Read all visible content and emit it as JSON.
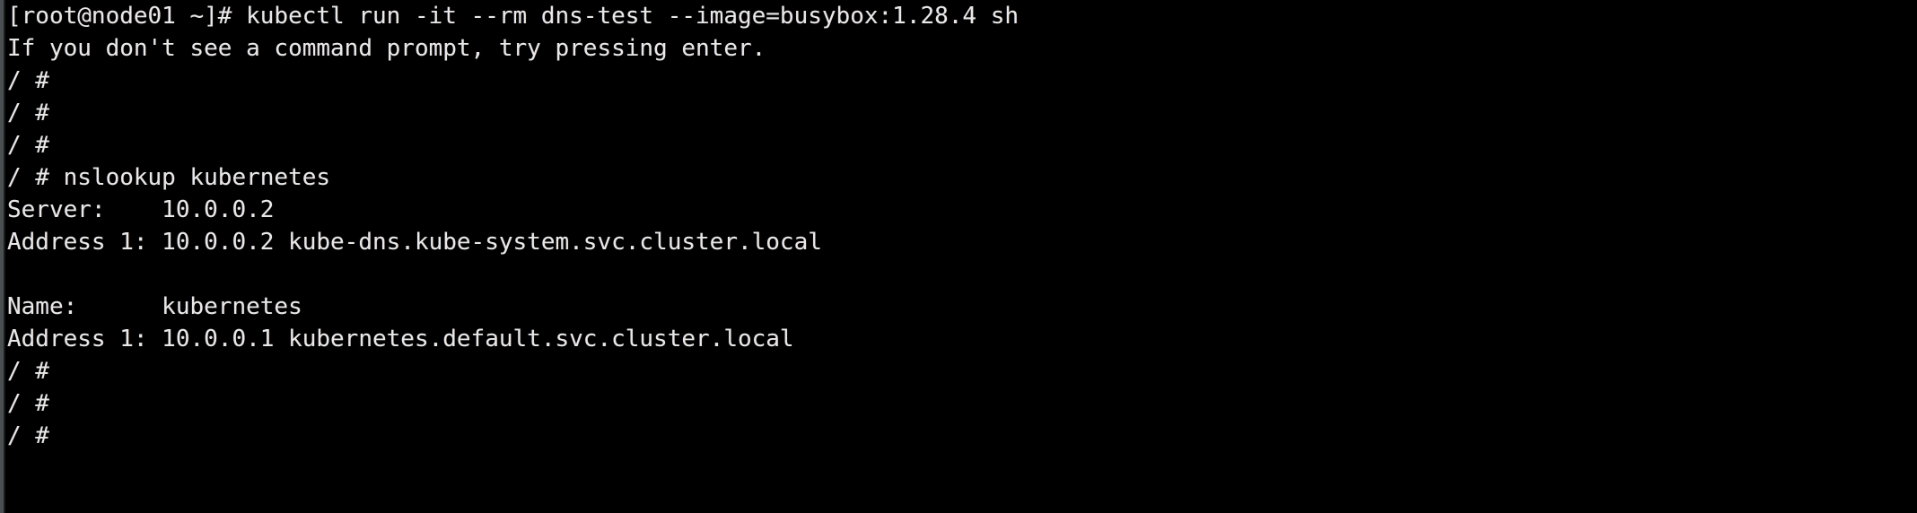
{
  "terminal": {
    "background_color": "#000000",
    "foreground_color": "#e8e8e8",
    "scrollbar_color": "#4a4f52",
    "hostname": "node01",
    "user": "root",
    "shell_prompt": "/ #",
    "lines": [
      {
        "id": "line-1",
        "text": "[root@node01 ~]# kubectl run -it --rm dns-test --image=busybox:1.28.4 sh"
      },
      {
        "id": "line-2",
        "text": "If you don't see a command prompt, try pressing enter."
      },
      {
        "id": "line-3",
        "text": "/ #"
      },
      {
        "id": "line-4",
        "text": "/ #"
      },
      {
        "id": "line-5",
        "text": "/ #"
      },
      {
        "id": "line-6",
        "text": "/ # nslookup kubernetes"
      },
      {
        "id": "line-7",
        "text": "Server:    10.0.0.2"
      },
      {
        "id": "line-8",
        "text": "Address 1: 10.0.0.2 kube-dns.kube-system.svc.cluster.local"
      },
      {
        "id": "line-9",
        "text": ""
      },
      {
        "id": "line-10",
        "text": "Name:      kubernetes"
      },
      {
        "id": "line-11",
        "text": "Address 1: 10.0.0.1 kubernetes.default.svc.cluster.local"
      },
      {
        "id": "line-12",
        "text": "/ #"
      },
      {
        "id": "line-13",
        "text": "/ #"
      },
      {
        "id": "line-14",
        "text": "/ #"
      }
    ],
    "commands": [
      {
        "prompt": "[root@node01 ~]#",
        "command": "kubectl run -it --rm dns-test --image=busybox:1.28.4 sh"
      },
      {
        "prompt": "/ #",
        "command": "nslookup kubernetes"
      }
    ],
    "nslookup_result": {
      "server_label": "Server:",
      "server_address": "10.0.0.2",
      "server_record_label": "Address 1:",
      "server_record_address": "10.0.0.2",
      "server_record_name": "kube-dns.kube-system.svc.cluster.local",
      "name_label": "Name:",
      "name_value": "kubernetes",
      "answer_label": "Address 1:",
      "answer_address": "10.0.0.1",
      "answer_name": "kubernetes.default.svc.cluster.local"
    }
  }
}
